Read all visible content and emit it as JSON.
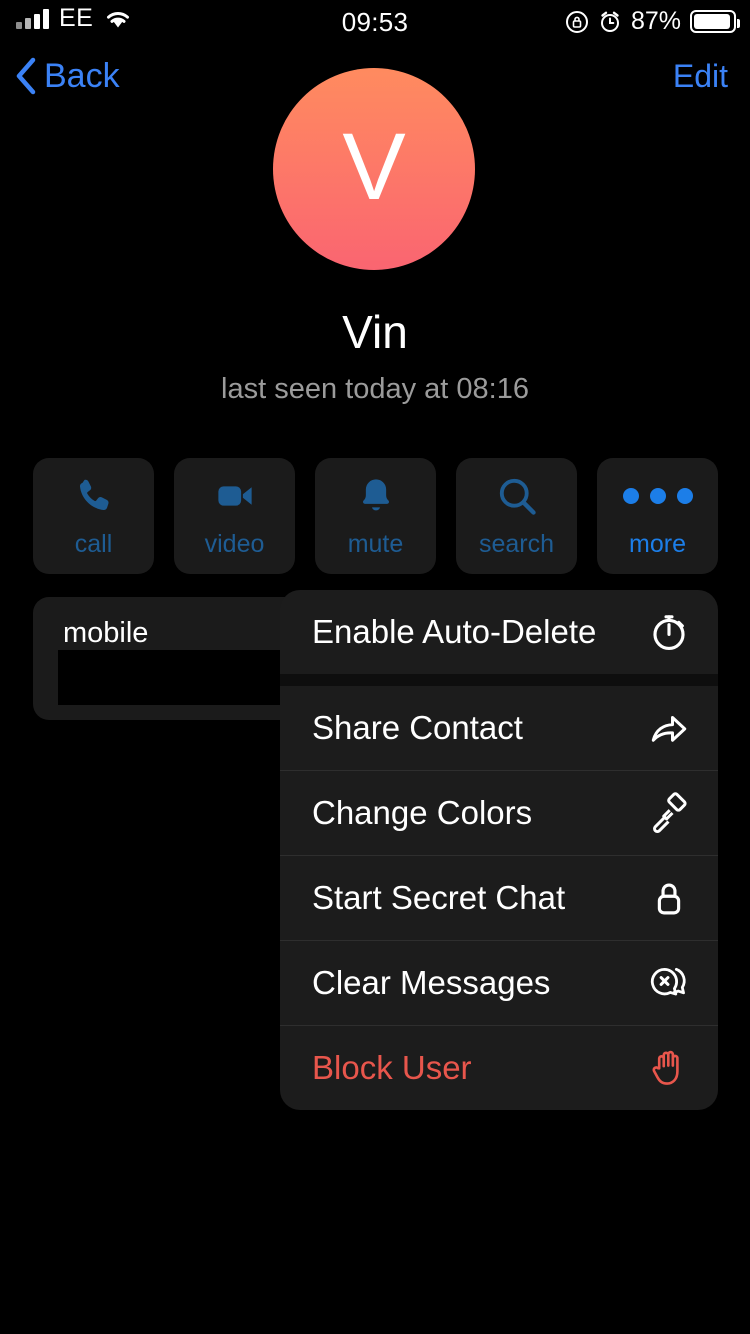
{
  "status_bar": {
    "carrier": "EE",
    "time": "09:53",
    "battery_percent": "87%",
    "icons": [
      "signal-bars-icon",
      "wifi-icon",
      "rotation-lock-icon",
      "alarm-clock-icon",
      "battery-icon"
    ]
  },
  "nav": {
    "back_label": "Back",
    "edit_label": "Edit"
  },
  "profile": {
    "avatar_letter": "V",
    "avatar_gradient_from": "#ff8b5f",
    "avatar_gradient_to": "#fa6571",
    "name": "Vin",
    "status": "last seen today at 08:16"
  },
  "actions": [
    {
      "label": "call",
      "icon": "phone-icon",
      "state": "dim"
    },
    {
      "label": "video",
      "icon": "video-camera-icon",
      "state": "dim"
    },
    {
      "label": "mute",
      "icon": "bell-icon",
      "state": "dim"
    },
    {
      "label": "search",
      "icon": "search-icon",
      "state": "dim"
    },
    {
      "label": "more",
      "icon": "ellipsis-icon",
      "state": "highlighted"
    }
  ],
  "contact_card": {
    "label": "mobile",
    "value": "",
    "value_redacted": true
  },
  "context_menu": {
    "items": [
      {
        "label": "Enable Auto-Delete",
        "icon": "stopwatch-icon",
        "destructive": false
      },
      {
        "label": "Share Contact",
        "icon": "share-arrow-icon",
        "destructive": false
      },
      {
        "label": "Change Colors",
        "icon": "paint-roller-icon",
        "destructive": false
      },
      {
        "label": "Start Secret Chat",
        "icon": "lock-icon",
        "destructive": false
      },
      {
        "label": "Clear Messages",
        "icon": "chat-bubble-x-icon",
        "destructive": false
      },
      {
        "label": "Block User",
        "icon": "stop-hand-icon",
        "destructive": true
      }
    ]
  },
  "colors": {
    "accent_blue": "#3b82f6",
    "action_blue_dim": "#1e5c93",
    "action_blue_bright": "#1c7ee8",
    "destructive_red": "#e8564c",
    "card_bg": "#1b1b1b",
    "menu_bg": "#1c1c1c",
    "screen_bg": "#000000"
  }
}
